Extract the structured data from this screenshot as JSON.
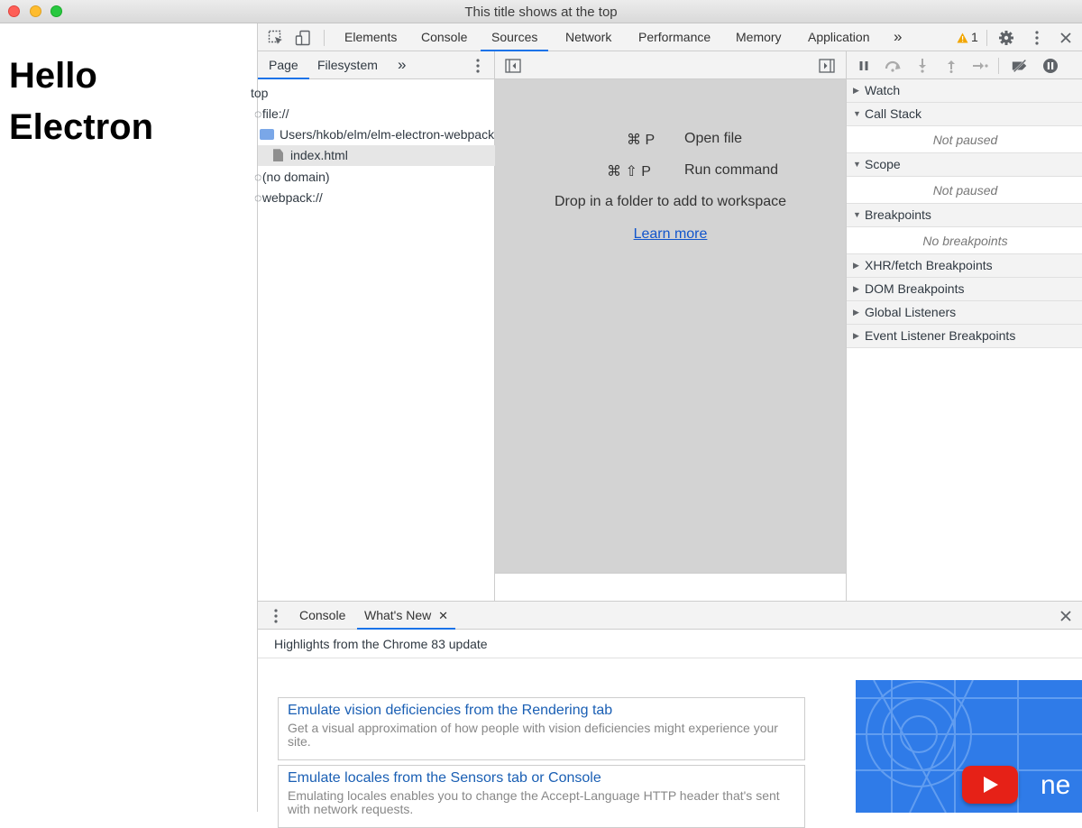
{
  "window": {
    "title": "This title shows at the top"
  },
  "page": {
    "heading_line1": "Hello",
    "heading_line2": "Electron"
  },
  "devtools": {
    "tabs": [
      "Elements",
      "Console",
      "Sources",
      "Network",
      "Performance",
      "Memory",
      "Application"
    ],
    "active_tab": "Sources",
    "more_tabs": "»",
    "warning_count": "1",
    "icons": [
      "inspect-element-icon",
      "device-toolbar-icon",
      "warning-icon",
      "gear-icon",
      "kebab-menu-icon",
      "close-icon"
    ]
  },
  "navigator": {
    "tabs": [
      "Page",
      "Filesystem"
    ],
    "more": "»",
    "tree": [
      {
        "label": "top"
      },
      {
        "label": "file://"
      },
      {
        "label": "Users/hkob/elm/elm-electron-webpack"
      },
      {
        "label": "index.html"
      },
      {
        "label": "(no domain)"
      },
      {
        "label": "webpack://"
      }
    ]
  },
  "editor": {
    "shortcut1_keys": "⌘ P",
    "shortcut1_label": "Open file",
    "shortcut2_keys": "⌘ ⇧ P",
    "shortcut2_label": "Run command",
    "drop_text": "Drop in a folder to add to workspace",
    "learn_more": "Learn more"
  },
  "debugger": {
    "sections": {
      "watch": "Watch",
      "call_stack": "Call Stack",
      "call_stack_body": "Not paused",
      "scope": "Scope",
      "scope_body": "Not paused",
      "breakpoints": "Breakpoints",
      "breakpoints_body": "No breakpoints",
      "xhr": "XHR/fetch Breakpoints",
      "dom": "DOM Breakpoints",
      "global": "Global Listeners",
      "event": "Event Listener Breakpoints"
    }
  },
  "drawer": {
    "tabs": [
      "Console",
      "What's New"
    ],
    "active_tab": "What's New",
    "subtitle": "Highlights from the Chrome 83 update",
    "cards": [
      {
        "title": "Emulate vision deficiencies from the Rendering tab",
        "desc": "Get a visual approximation of how people with vision deficiencies might experience your site."
      },
      {
        "title": "Emulate locales from the Sensors tab or Console",
        "desc": "Emulating locales enables you to change the Accept-Language HTTP header that's sent with network requests."
      }
    ],
    "promo_text": "ne"
  },
  "colors": {
    "accent": "#1a73e8",
    "link": "#1155cc",
    "promo_bg": "#2f7be8",
    "play_red": "#e62117"
  }
}
